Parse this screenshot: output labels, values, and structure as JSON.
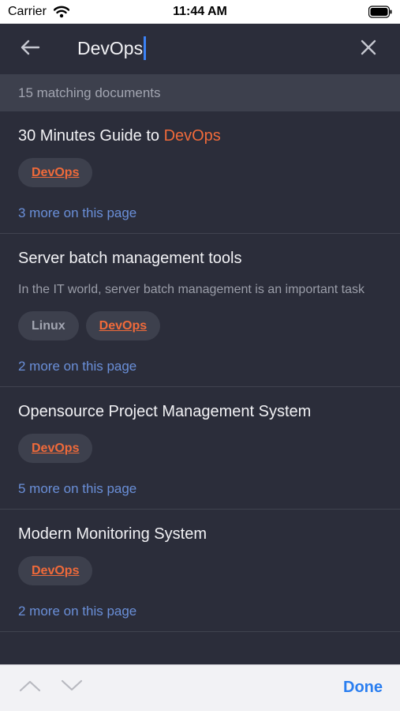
{
  "status_bar": {
    "carrier": "Carrier",
    "time": "11:44 AM"
  },
  "search": {
    "query": "DevOps"
  },
  "results_count": "15 matching documents",
  "results": [
    {
      "title_prefix": "30 Minutes Guide to ",
      "title_highlight": "DevOps",
      "snippet": "",
      "tags": [
        {
          "label": "DevOps",
          "highlighted": true
        }
      ],
      "more": "3 more on this page"
    },
    {
      "title_prefix": "Server batch management tools",
      "title_highlight": "",
      "snippet": "In the IT world, server batch management is an important task",
      "tags": [
        {
          "label": "Linux",
          "highlighted": false
        },
        {
          "label": "DevOps",
          "highlighted": true
        }
      ],
      "more": "2 more on this page"
    },
    {
      "title_prefix": "Opensource Project Management System",
      "title_highlight": "",
      "snippet": "",
      "tags": [
        {
          "label": "DevOps",
          "highlighted": true
        }
      ],
      "more": "5 more on this page"
    },
    {
      "title_prefix": "Modern Monitoring System",
      "title_highlight": "",
      "snippet": "",
      "tags": [
        {
          "label": "DevOps",
          "highlighted": true
        }
      ],
      "more": "2 more on this page"
    }
  ],
  "toolbar": {
    "done_label": "Done"
  },
  "colors": {
    "highlight": "#f06a3a",
    "link": "#6a8fd8",
    "accent": "#2a7ef0"
  }
}
